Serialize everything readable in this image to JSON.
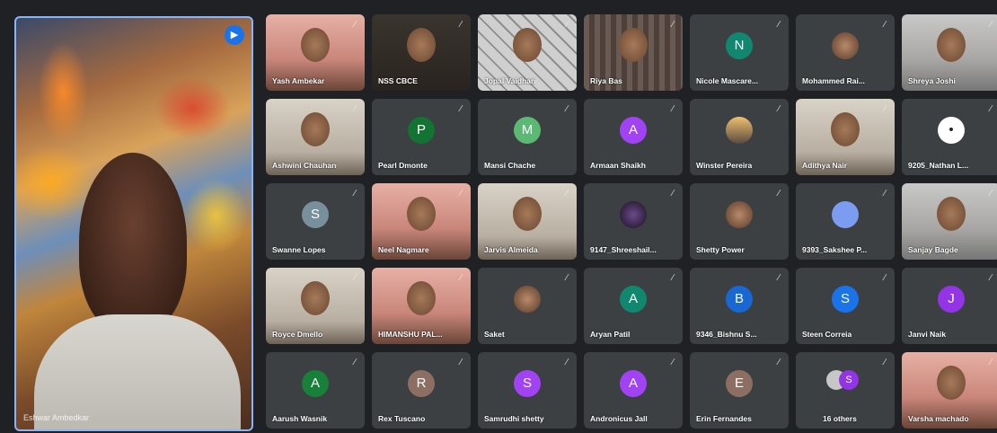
{
  "main": {
    "name": "Eshwar Ambedkar",
    "audio_icon": "audio-active-icon"
  },
  "tiles": [
    {
      "name": "Yash Ambekar",
      "kind": "photo",
      "style": "pink"
    },
    {
      "name": "NSS CBCE",
      "kind": "photo",
      "style": "dark"
    },
    {
      "name": "Jopal Vaidhan",
      "kind": "photo",
      "style": "lattice"
    },
    {
      "name": "Riya Bas",
      "kind": "photo",
      "style": "curtain"
    },
    {
      "name": "Nicole Mascare...",
      "kind": "letter",
      "letter": "N",
      "color": "#12876f"
    },
    {
      "name": "Mohammed Rai...",
      "kind": "avatar",
      "style": "img"
    },
    {
      "name": "Shreya Joshi",
      "kind": "photo",
      "style": "grey"
    },
    {
      "name": "Ashwini Chauhan",
      "kind": "photo",
      "style": "light"
    },
    {
      "name": "Pearl Dmonte",
      "kind": "letter",
      "letter": "P",
      "color": "#137333"
    },
    {
      "name": "Mansi Chache",
      "kind": "letter",
      "letter": "M",
      "color": "#5bb974"
    },
    {
      "name": "Armaan Shaikh",
      "kind": "letter",
      "letter": "A",
      "color": "#a142f4"
    },
    {
      "name": "Winster Pereira",
      "kind": "avatar",
      "style": "sunset"
    },
    {
      "name": "Adithya Nair",
      "kind": "photo",
      "style": "light"
    },
    {
      "name": "9205_Nathan L...",
      "kind": "avatar",
      "style": "white-img"
    },
    {
      "name": "Swanne Lopes",
      "kind": "letter",
      "letter": "S",
      "color": "#78909c"
    },
    {
      "name": "Neel Nagmare",
      "kind": "photo",
      "style": "pink"
    },
    {
      "name": "Jarvis Almeida",
      "kind": "photo",
      "style": "light"
    },
    {
      "name": "9147_Shreeshail...",
      "kind": "avatar",
      "style": "dark-img"
    },
    {
      "name": "Shetty Power",
      "kind": "avatar",
      "style": "img"
    },
    {
      "name": "9393_Sakshee P...",
      "kind": "avatar",
      "style": "generic"
    },
    {
      "name": "Sanjay Bagde",
      "kind": "photo",
      "style": "grey"
    },
    {
      "name": "Royce Dmello",
      "kind": "photo",
      "style": "light"
    },
    {
      "name": "HIMANSHU PAL...",
      "kind": "photo",
      "style": "pink"
    },
    {
      "name": "Saket",
      "kind": "avatar",
      "style": "img"
    },
    {
      "name": "Aryan Patil",
      "kind": "letter",
      "letter": "A",
      "color": "#12876f"
    },
    {
      "name": "9346_Bishnu S...",
      "kind": "letter",
      "letter": "B",
      "color": "#1967d2"
    },
    {
      "name": "Steen Correia",
      "kind": "letter",
      "letter": "S",
      "color": "#1a73e8"
    },
    {
      "name": "Janvi Naik",
      "kind": "letter",
      "letter": "J",
      "color": "#9334e6"
    },
    {
      "name": "Aarush Wasnik",
      "kind": "letter",
      "letter": "A",
      "color": "#188038"
    },
    {
      "name": "Rex Tuscano",
      "kind": "letter",
      "letter": "R",
      "color": "#8d6e63"
    },
    {
      "name": "Samrudhi shetty",
      "kind": "letter",
      "letter": "S",
      "color": "#a142f4"
    },
    {
      "name": "Andronicus Jall",
      "kind": "letter",
      "letter": "A",
      "color": "#a142f4"
    },
    {
      "name": "Erin Fernandes",
      "kind": "letter",
      "letter": "E",
      "color": "#8d6e63"
    },
    {
      "name": "16 others",
      "kind": "others",
      "letter": "S"
    },
    {
      "name": "Varsha machado",
      "kind": "photo",
      "style": "pink"
    }
  ],
  "icons": {
    "mic": "mic-off-icon"
  }
}
